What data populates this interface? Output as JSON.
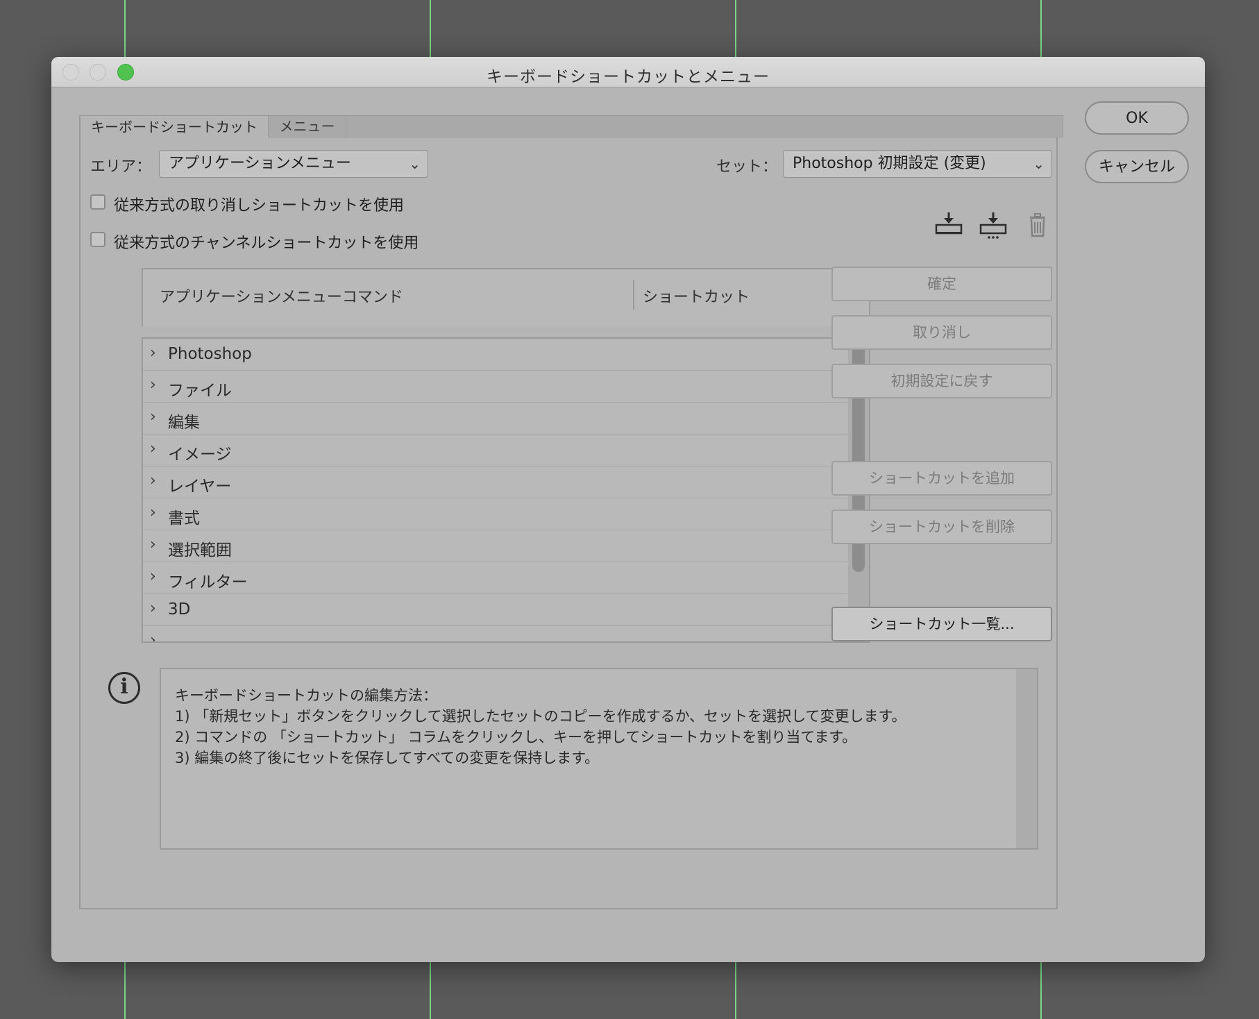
{
  "window": {
    "title": "キーボードショートカットとメニュー"
  },
  "actions": {
    "ok": "OK",
    "cancel": "キャンセル"
  },
  "tabs": [
    {
      "label": "キーボードショートカット",
      "active": true
    },
    {
      "label": "メニュー",
      "active": false
    }
  ],
  "area": {
    "label": "エリア：",
    "value": "アプリケーションメニュー"
  },
  "set": {
    "label": "セット：",
    "value": "Photoshop 初期設定 (変更)"
  },
  "options": {
    "legacy_undo": {
      "label": "従来方式の取り消しショートカットを使用",
      "checked": false
    },
    "legacy_channel": {
      "label": "従来方式のチャンネルショートカットを使用",
      "checked": false
    }
  },
  "set_tools": {
    "save_icon": "save-set-icon",
    "new_icon": "new-set-icon",
    "delete_icon": "trash-icon"
  },
  "table": {
    "col_command": "アプリケーションメニューコマンド",
    "col_shortcut": "ショートカット",
    "rows": [
      {
        "label": "Photoshop"
      },
      {
        "label": "ファイル"
      },
      {
        "label": "編集"
      },
      {
        "label": "イメージ"
      },
      {
        "label": "レイヤー"
      },
      {
        "label": "書式"
      },
      {
        "label": "選択範囲"
      },
      {
        "label": "フィルター"
      },
      {
        "label": "3D"
      }
    ]
  },
  "side_buttons": {
    "accept": "確定",
    "undo": "取り消し",
    "use_default": "初期設定に戻す",
    "add_shortcut": "ショートカットを追加",
    "delete_shortcut": "ショートカットを削除",
    "summarize": "ショートカット一覧..."
  },
  "info": {
    "line1": "キーボードショートカットの編集方法：",
    "line2": "1) 「新規セット」ボタンをクリックして選択したセットのコピーを作成するか、セットを選択して変更します。",
    "line3": "2) コマンドの 「ショートカット」 コラムをクリックし、キーを押してショートカットを割り当てます。",
    "line4": "3) 編集の終了後にセットを保存してすべての変更を保持します。"
  },
  "colors": {
    "background": "#5a5a5a",
    "dialog": "#b5b5b5",
    "guide_line": "#7bd88a",
    "maximize": "#4fc24f"
  }
}
